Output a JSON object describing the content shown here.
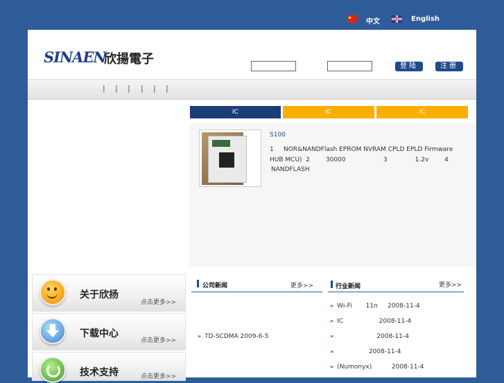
{
  "lang": {
    "chinese": "中文",
    "english": "English"
  },
  "brand": {
    "logo_text": "SINAEN",
    "logo_cn": "欣揚電子"
  },
  "login": {
    "login_label": "登陆",
    "register_label": "注册"
  },
  "nav": {
    "separators": [
      "|",
      "|",
      "|",
      "|",
      "|",
      "|"
    ]
  },
  "tabs": [
    "IC",
    "IC",
    "IC"
  ],
  "product": {
    "name": "S100",
    "line1": "1     NOR&NANDFlash EPROM NVRAM CPLD EPLD Firmware",
    "line2": "HUB MCU)  2        30000                   3              1.2v        4",
    "line3": "NANDFLASH"
  },
  "sidebar": [
    {
      "title": "关于欣扬",
      "more": "点击更多>>",
      "icon": "smiley-icon",
      "color": "#f6a21a"
    },
    {
      "title": "下载中心",
      "more": "点击更多>>",
      "icon": "download-arrow-icon",
      "color": "#4a8fd8"
    },
    {
      "title": "技术支持",
      "more": "点击更多>>",
      "icon": "refresh-icon",
      "color": "#4caf3a"
    }
  ],
  "company_news": {
    "title": "公司新闻",
    "more": "更多>>",
    "items": [
      {
        "text": "TD-SCDMA 2009-6-5"
      }
    ]
  },
  "industry_news": {
    "title": "行业新闻",
    "more": "更多>>",
    "items": [
      {
        "text": "Wi-Fi       11n     2008-11-4"
      },
      {
        "text": "IC                  2008-11-4"
      },
      {
        "text": "                    2008-11-4"
      },
      {
        "text": "                2008-11-4"
      },
      {
        "text": "(Numonyx)          2008-11-4"
      }
    ]
  }
}
